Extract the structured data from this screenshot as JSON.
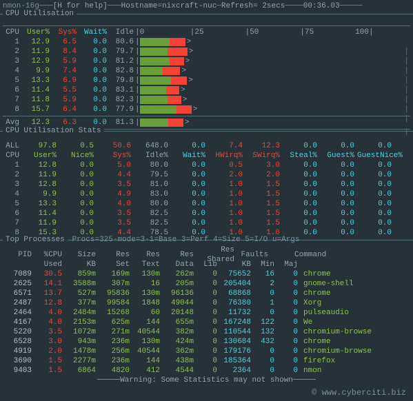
{
  "header": {
    "app": "nmon-16g",
    "help": "[H for help]",
    "host_label": "Hostname=",
    "host": "nixcraft-nuc",
    "refresh_label": "Refresh=",
    "refresh": "2secs",
    "time": "00:36.03"
  },
  "cpu_util": {
    "title": "CPU Utilisation",
    "cols": [
      "CPU",
      "User%",
      "Sys%",
      "Wait%",
      "Idle"
    ],
    "scale": [
      "|0",
      "|25",
      "|50",
      "|75",
      "100|"
    ],
    "rows": [
      {
        "n": "1",
        "user": "12.9",
        "sys": "6.5",
        "wait": "0.0",
        "idle": "80.6"
      },
      {
        "n": "2",
        "user": "11.9",
        "sys": "8.4",
        "wait": "0.0",
        "idle": "79.7"
      },
      {
        "n": "3",
        "user": "12.9",
        "sys": "5.9",
        "wait": "0.0",
        "idle": "81.2"
      },
      {
        "n": "4",
        "user": "9.9",
        "sys": "7.4",
        "wait": "0.0",
        "idle": "82.8"
      },
      {
        "n": "5",
        "user": "13.3",
        "sys": "6.9",
        "wait": "0.0",
        "idle": "79.8"
      },
      {
        "n": "6",
        "user": "11.4",
        "sys": "5.5",
        "wait": "0.0",
        "idle": "83.1"
      },
      {
        "n": "7",
        "user": "11.8",
        "sys": "5.9",
        "wait": "0.0",
        "idle": "82.3"
      },
      {
        "n": "8",
        "user": "15.7",
        "sys": "6.4",
        "wait": "0.0",
        "idle": "77.9"
      }
    ],
    "avg": {
      "n": "Avg",
      "user": "12.3",
      "sys": "6.3",
      "wait": "0.0",
      "idle": "81.3"
    }
  },
  "cpu_stats": {
    "title": "CPU Utilisation Stats",
    "all_row": [
      "ALL",
      "97.8",
      "0.5",
      "50.6",
      "648.0",
      "0.0",
      "7.4",
      "12.3",
      "0.0",
      "0.0",
      "0.0"
    ],
    "cols": [
      "CPU",
      "User%",
      "Nice%",
      "Sys%",
      "Idle%",
      "Wait%",
      "HWirq%",
      "SWirq%",
      "Steal%",
      "Guest%",
      "GuestNice%"
    ],
    "rows": [
      [
        "1",
        "12.8",
        "0.0",
        "5.0",
        "80.0",
        "0.0",
        "0.5",
        "3.0",
        "0.0",
        "0.0",
        "0.0"
      ],
      [
        "2",
        "11.9",
        "0.0",
        "4.4",
        "79.5",
        "0.0",
        "2.0",
        "2.0",
        "0.0",
        "0.0",
        "0.0"
      ],
      [
        "3",
        "12.8",
        "0.0",
        "3.5",
        "81.0",
        "0.0",
        "1.0",
        "1.5",
        "0.0",
        "0.0",
        "0.0"
      ],
      [
        "4",
        "9.9",
        "0.0",
        "4.9",
        "83.0",
        "0.0",
        "1.0",
        "1.5",
        "0.0",
        "0.0",
        "0.0"
      ],
      [
        "5",
        "13.3",
        "0.0",
        "4.0",
        "80.0",
        "0.0",
        "1.0",
        "1.5",
        "0.0",
        "0.0",
        "0.0"
      ],
      [
        "6",
        "11.4",
        "0.0",
        "3.5",
        "82.5",
        "0.0",
        "1.0",
        "1.5",
        "0.0",
        "0.0",
        "0.0"
      ],
      [
        "7",
        "11.9",
        "0.0",
        "3.5",
        "82.5",
        "0.0",
        "1.0",
        "1.5",
        "0.0",
        "0.0",
        "0.0"
      ],
      [
        "8",
        "15.3",
        "0.0",
        "4.4",
        "78.5",
        "0.0",
        "1.0",
        "1.0",
        "0.0",
        "0.0",
        "0.0"
      ]
    ]
  },
  "top": {
    "title": "Top Processes",
    "meta": "Procs=325-mode=3-1=Base 3=Perf 4=Size 5=I/O u=Args",
    "cols1": [
      "PID",
      "%CPU",
      "Size",
      "Res",
      "Res",
      "Res",
      "Res Shared",
      "",
      "Faults",
      "Command"
    ],
    "cols2": [
      "",
      "Used",
      "KB",
      "Set",
      "Text",
      "Data",
      "Lib",
      "KB",
      "Min",
      "Maj",
      ""
    ],
    "rows": [
      {
        "pid": "7089",
        "cpu": "30.5",
        "size": "859m",
        "set": "169m",
        "text": "130m",
        "data": "262m",
        "lib": "0",
        "kb": "75652",
        "min": "16",
        "maj": "0",
        "cmd": "chrome"
      },
      {
        "pid": "2625",
        "cpu": "14.1",
        "size": "3588m",
        "set": "307m",
        "text": "16",
        "data": "205m",
        "lib": "0",
        "kb": "205404",
        "min": "2",
        "maj": "0",
        "cmd": "gnome-shell"
      },
      {
        "pid": "6571",
        "cpu": "13.7",
        "size": "527m",
        "set": "95836",
        "text": "130m",
        "data": "96136",
        "lib": "0",
        "kb": "68868",
        "min": "0",
        "maj": "0",
        "cmd": "chrome"
      },
      {
        "pid": "2487",
        "cpu": "12.8",
        "size": "377m",
        "set": "99584",
        "text": "1848",
        "data": "49044",
        "lib": "0",
        "kb": "76380",
        "min": "1",
        "maj": "0",
        "cmd": "Xorg"
      },
      {
        "pid": "2464",
        "cpu": "4.0",
        "size": "2484m",
        "set": "15268",
        "text": "60",
        "data": "20148",
        "lib": "0",
        "kb": "11732",
        "min": "0",
        "maj": "0",
        "cmd": "pulseaudio"
      },
      {
        "pid": "4167",
        "cpu": "4.0",
        "size": "2153m",
        "set": "625m",
        "text": "144",
        "data": "655m",
        "lib": "0",
        "kb": "167248",
        "min": "122",
        "maj": "0",
        "cmd": "We"
      },
      {
        "pid": "5220",
        "cpu": "3.5",
        "size": "1072m",
        "set": "271m",
        "text": "40544",
        "data": "382m",
        "lib": "0",
        "kb": "110544",
        "min": "132",
        "maj": "0",
        "cmd": "chromium-browse"
      },
      {
        "pid": "6528",
        "cpu": "3.0",
        "size": "943m",
        "set": "236m",
        "text": "130m",
        "data": "424m",
        "lib": "0",
        "kb": "130684",
        "min": "432",
        "maj": "0",
        "cmd": "chrome"
      },
      {
        "pid": "4919",
        "cpu": "2.0",
        "size": "1478m",
        "set": "256m",
        "text": "40544",
        "data": "362m",
        "lib": "0",
        "kb": "179176",
        "min": "0",
        "maj": "0",
        "cmd": "chromium-browse"
      },
      {
        "pid": "3690",
        "cpu": "1.5",
        "size": "2277m",
        "set": "236m",
        "text": "144",
        "data": "438m",
        "lib": "0",
        "kb": "185364",
        "min": "0",
        "maj": "0",
        "cmd": "firefox"
      },
      {
        "pid": "9403",
        "cpu": "1.5",
        "size": "6864",
        "set": "4820",
        "text": "412",
        "data": "4544",
        "lib": "0",
        "kb": "2364",
        "min": "0",
        "maj": "0",
        "cmd": "nmon"
      }
    ],
    "warning": "Warning: Some Statistics may not shown"
  },
  "footer": "© www.cyberciti.biz"
}
